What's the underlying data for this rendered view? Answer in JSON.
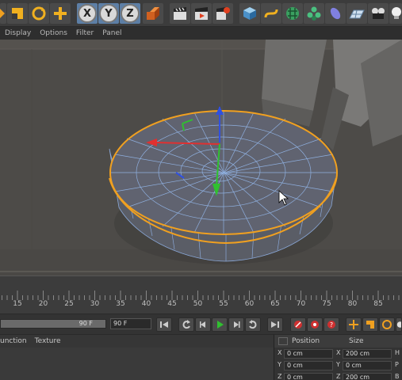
{
  "toolbar": {
    "axis_x": "X",
    "axis_y": "Y",
    "axis_z": "Z"
  },
  "menubar": {
    "items": [
      "Display",
      "Options",
      "Filter",
      "Panel"
    ]
  },
  "timeline": {
    "ticks": [
      "15",
      "20",
      "25",
      "30",
      "35",
      "40",
      "45",
      "50",
      "55",
      "60",
      "65",
      "70",
      "75",
      "80",
      "85"
    ]
  },
  "transport": {
    "slider_value": "90 F",
    "end_frame": "90 F"
  },
  "bottom_left": {
    "tabs": [
      "unction",
      "Texture"
    ]
  },
  "coordinates": {
    "position_label": "Position",
    "size_label": "Size",
    "rows": [
      {
        "axis": "X",
        "position": "0 cm",
        "size_axis": "X",
        "size": "200 cm",
        "rot_axis": "H"
      },
      {
        "axis": "Y",
        "position": "0 cm",
        "size_axis": "Y",
        "size": "0 cm",
        "rot_axis": "P"
      },
      {
        "axis": "Z",
        "position": "0 cm",
        "size_axis": "Z",
        "size": "200 cm",
        "rot_axis": "B"
      }
    ]
  },
  "colors": {
    "selection_outline": "#f0a020",
    "axis_x": "#e03030",
    "axis_y": "#30c030",
    "axis_z": "#3050e0"
  }
}
